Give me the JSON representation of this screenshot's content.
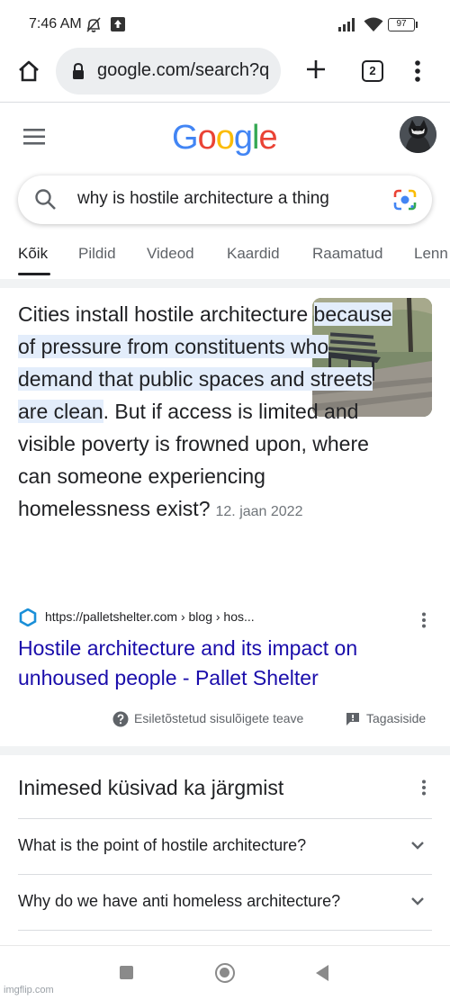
{
  "status_bar": {
    "time": "7:46 AM",
    "battery": "97",
    "icons": [
      "mute-icon",
      "upload-notification-icon",
      "signal-icon",
      "wifi-icon",
      "battery-icon"
    ]
  },
  "browser": {
    "url": "google.com/search?q",
    "tab_count": "2",
    "icons": [
      "home-icon",
      "lock-icon",
      "new-tab-icon",
      "tab-switcher-icon",
      "more-vert-icon"
    ]
  },
  "google": {
    "logo_letters": [
      "G",
      "o",
      "o",
      "g",
      "l",
      "e"
    ],
    "logo_colors": [
      "#4285F4",
      "#EA4335",
      "#FBBC05",
      "#4285F4",
      "#34A853",
      "#EA4335"
    ],
    "query": "why is hostile architecture a thing"
  },
  "tabs": [
    {
      "label": "Kõik",
      "active": true
    },
    {
      "label": "Pildid"
    },
    {
      "label": "Videod"
    },
    {
      "label": "Kaardid"
    },
    {
      "label": "Raamatud"
    },
    {
      "label": "Lenn"
    }
  ],
  "snippet": {
    "text_before": "Cities install hostile architecture ",
    "highlight": "because of pressure from constituents who demand that public spaces and streets are clean",
    "text_after": ". But if access is limited and visible poverty is frowned upon, where can someone experiencing homelessness exist?",
    "date": "12. jaan 2022"
  },
  "source": {
    "url": "https://palletshelter.com › blog › hos...",
    "title": "Hostile architecture and its impact on unhoused people - Pallet Shelter"
  },
  "snippet_footer": {
    "about": "Esiletõstetud sisulõigete teave",
    "feedback": "Tagasiside"
  },
  "paa": {
    "title": "Inimesed küsivad ka järgmist",
    "questions": [
      "What is the point of hostile architecture?",
      "Why do we have anti homeless architecture?"
    ]
  },
  "watermark": "imgflip.com",
  "colors": {
    "link": "#1a0dab",
    "highlight": "#e3edfb",
    "secondary_text": "#5f6368"
  }
}
